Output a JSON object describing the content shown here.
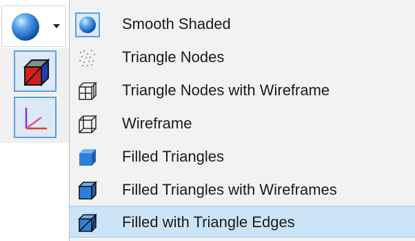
{
  "toolbar": {
    "split_button_icon": "shaded-sphere-icon",
    "split_button_caret": "chevron-down-icon",
    "tools": [
      {
        "icon": "cube-color-icon"
      },
      {
        "icon": "axes-icon"
      }
    ]
  },
  "menu": {
    "items": [
      {
        "label": "Smooth Shaded",
        "icon": "shaded-sphere-icon",
        "selected": false
      },
      {
        "label": "Triangle Nodes",
        "icon": "point-cloud-icon",
        "selected": false
      },
      {
        "label": "Triangle Nodes with Wireframe",
        "icon": "nodes-wireframe-cube-icon",
        "selected": false
      },
      {
        "label": "Wireframe",
        "icon": "wireframe-cube-icon",
        "selected": false
      },
      {
        "label": "Filled Triangles",
        "icon": "filled-cube-icon",
        "selected": false
      },
      {
        "label": "Filled Triangles with Wireframes",
        "icon": "filled-wireframe-cube-icon",
        "selected": false
      },
      {
        "label": "Filled with Triangle Edges",
        "icon": "filled-edges-cube-icon",
        "selected": true
      }
    ]
  },
  "colors": {
    "selection_bg": "#cce4f7",
    "selection_border": "#99c9ef",
    "menu_bg": "#f2f2f2",
    "accent_blue": "#2f7fd6"
  }
}
